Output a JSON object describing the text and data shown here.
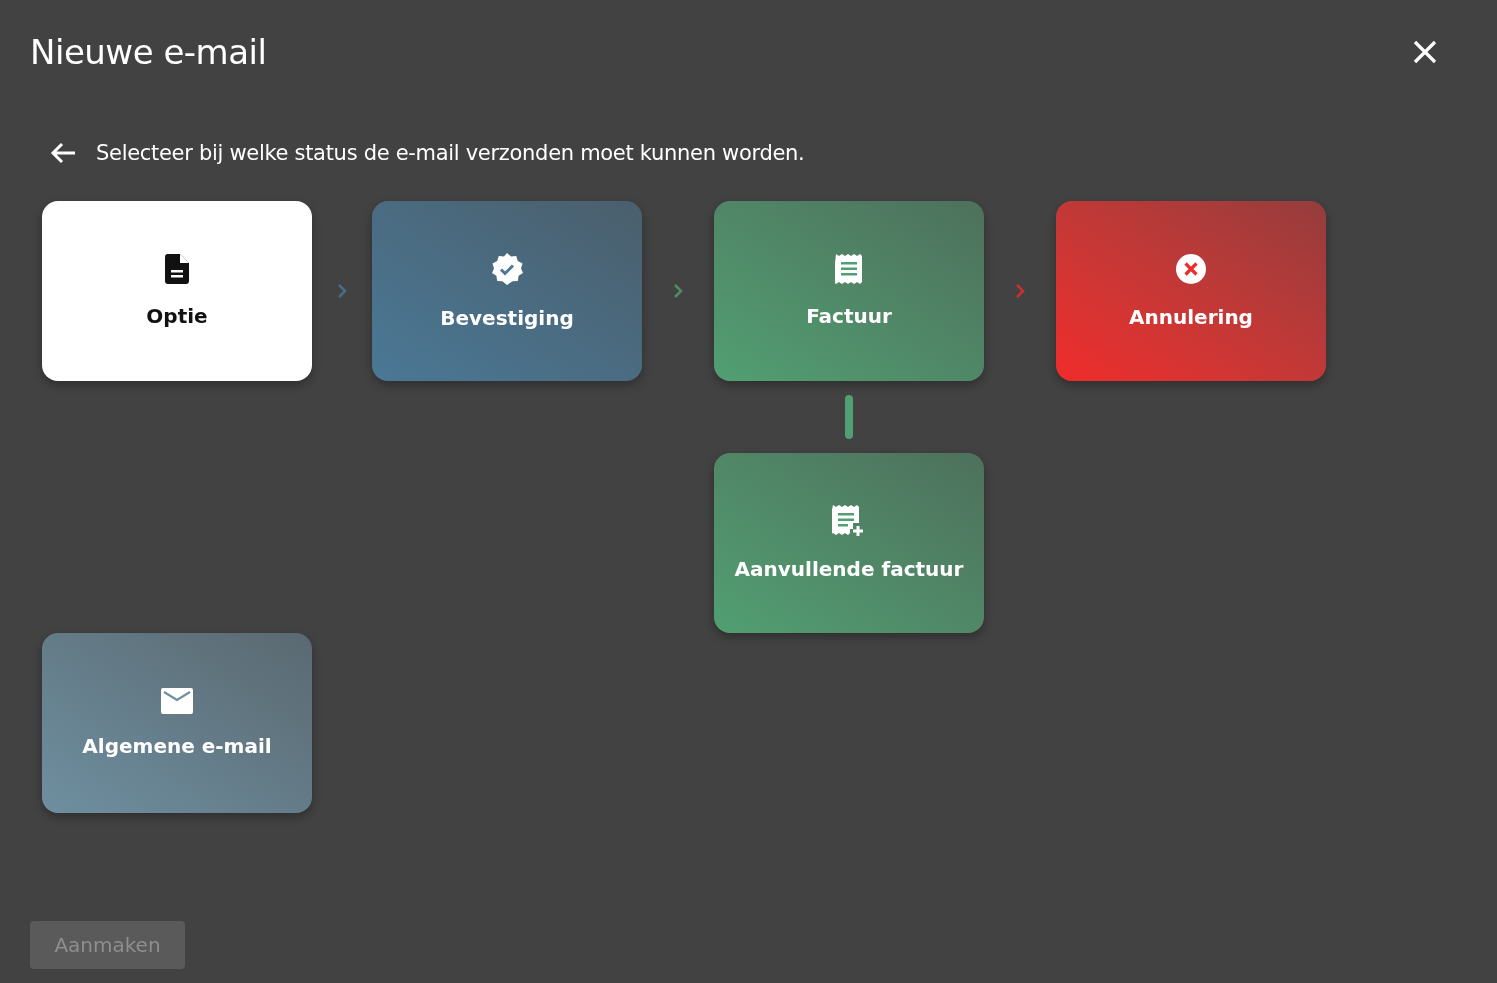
{
  "dialog": {
    "title": "Nieuwe e-mail",
    "instruction": "Selecteer bij welke status de e-mail verzonden moet kunnen worden."
  },
  "flow": [
    {
      "label": "Optie",
      "color": "#ffffff"
    },
    {
      "label": "Bevestiging",
      "color": "#4a7896"
    },
    {
      "label": "Factuur",
      "color": "#519f72"
    },
    {
      "label": "Annulering",
      "color": "#f02b2b"
    }
  ],
  "branch": {
    "label": "Aanvullende factuur",
    "color": "#519f72"
  },
  "general": {
    "label": "Algemene e-mail",
    "color": "#6e8fa0"
  },
  "create_button": {
    "label": "Aanmaken",
    "disabled": true
  }
}
